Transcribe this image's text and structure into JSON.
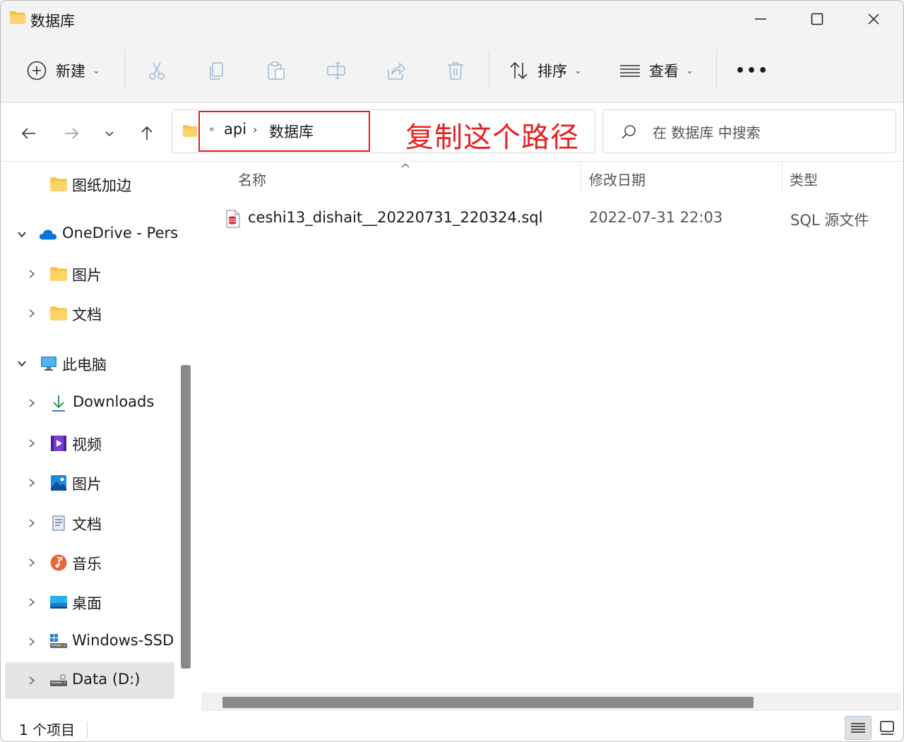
{
  "window": {
    "title": "数据库"
  },
  "toolbar": {
    "new_label": "新建",
    "sort_label": "排序",
    "view_label": "查看",
    "more_label": "•••"
  },
  "address": {
    "overflow": "«",
    "crumbs": [
      "api",
      "数据库"
    ],
    "separator": "›",
    "annotation": "复制这个路径"
  },
  "search": {
    "placeholder": "在 数据库 中搜索"
  },
  "sidebar": {
    "items": [
      {
        "label": "图纸加边",
        "icon": "folder-icon"
      },
      {
        "label": "OneDrive - Pers",
        "icon": "onedrive-cloud-icon"
      },
      {
        "label": "图片",
        "icon": "folder-icon"
      },
      {
        "label": "文档",
        "icon": "folder-icon"
      },
      {
        "label": "此电脑",
        "icon": "computer-icon"
      },
      {
        "label": "Downloads",
        "icon": "download-arrow-icon"
      },
      {
        "label": "视频",
        "icon": "video-icon"
      },
      {
        "label": "图片",
        "icon": "pictures-icon"
      },
      {
        "label": "文档",
        "icon": "documents-icon"
      },
      {
        "label": "音乐",
        "icon": "music-icon"
      },
      {
        "label": "桌面",
        "icon": "desktop-icon"
      },
      {
        "label": "Windows-SSD",
        "icon": "drive-icon"
      },
      {
        "label": "Data (D:)",
        "icon": "drive-icon"
      }
    ]
  },
  "columns": {
    "name": "名称",
    "modified": "修改日期",
    "type": "类型"
  },
  "files": [
    {
      "name": "ceshi13_dishait__20220731_220324.sql",
      "modified": "2022-07-31 22:03",
      "type": "SQL 源文件",
      "icon": "sql-file-icon"
    }
  ],
  "status": {
    "count": "1 个项目"
  },
  "colors": {
    "folder": "#f6c344",
    "annotation_red": "#e81c1c",
    "accent": "#0067c0"
  }
}
